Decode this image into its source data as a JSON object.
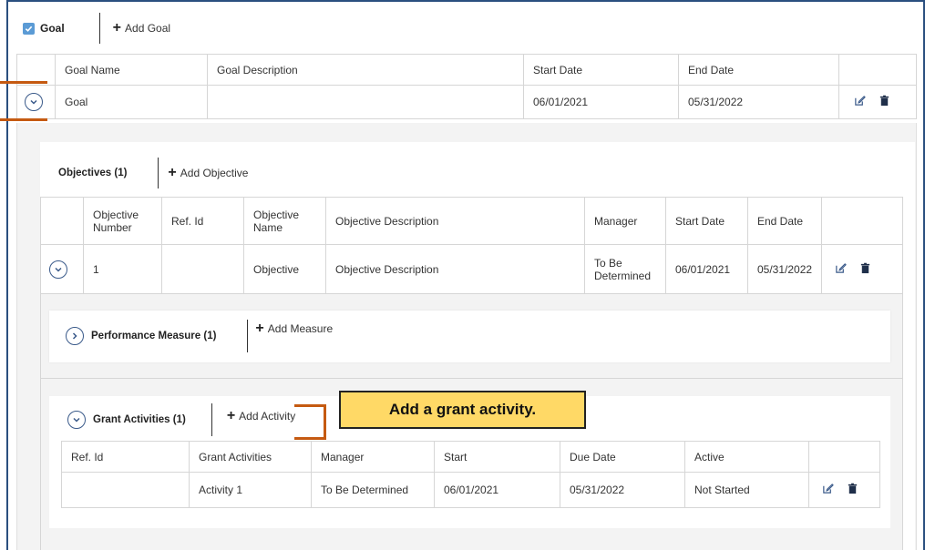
{
  "goal_section": {
    "label": "Goal",
    "add_label": "Add Goal",
    "columns": [
      "Goal Name",
      "Goal Description",
      "Start Date",
      "End Date"
    ],
    "row": {
      "name": "Goal",
      "description": "",
      "start": "06/01/2021",
      "end": "05/31/2022"
    }
  },
  "objectives": {
    "title": "Objectives (1)",
    "add_label": "Add Objective",
    "columns": [
      "Objective Number",
      "Ref. Id",
      "Objective Name",
      "Objective Description",
      "Manager",
      "Start Date",
      "End Date"
    ],
    "row": {
      "number": "1",
      "ref_id": "",
      "name": "Objective",
      "description": "Objective Description",
      "manager": "To Be Determined",
      "start": "06/01/2021",
      "end": "05/31/2022"
    }
  },
  "performance_measure": {
    "title": "Performance Measure (1)",
    "add_label": "Add Measure"
  },
  "grant_activities": {
    "title": "Grant Activities (1)",
    "add_label": "Add Activity",
    "columns": [
      "Ref. Id",
      "Grant Activities",
      "Manager",
      "Start",
      "Due Date",
      "Active"
    ],
    "row": {
      "ref_id": "",
      "activity": "Activity 1",
      "manager": "To Be Determined",
      "start": "06/01/2021",
      "due": "05/31/2022",
      "active": "Not Started"
    }
  },
  "callout": {
    "text": "Add a grant activity."
  },
  "colors": {
    "accent": "#c55a11",
    "tooltip_bg": "#ffd966",
    "frame": "#2a4f7f"
  }
}
